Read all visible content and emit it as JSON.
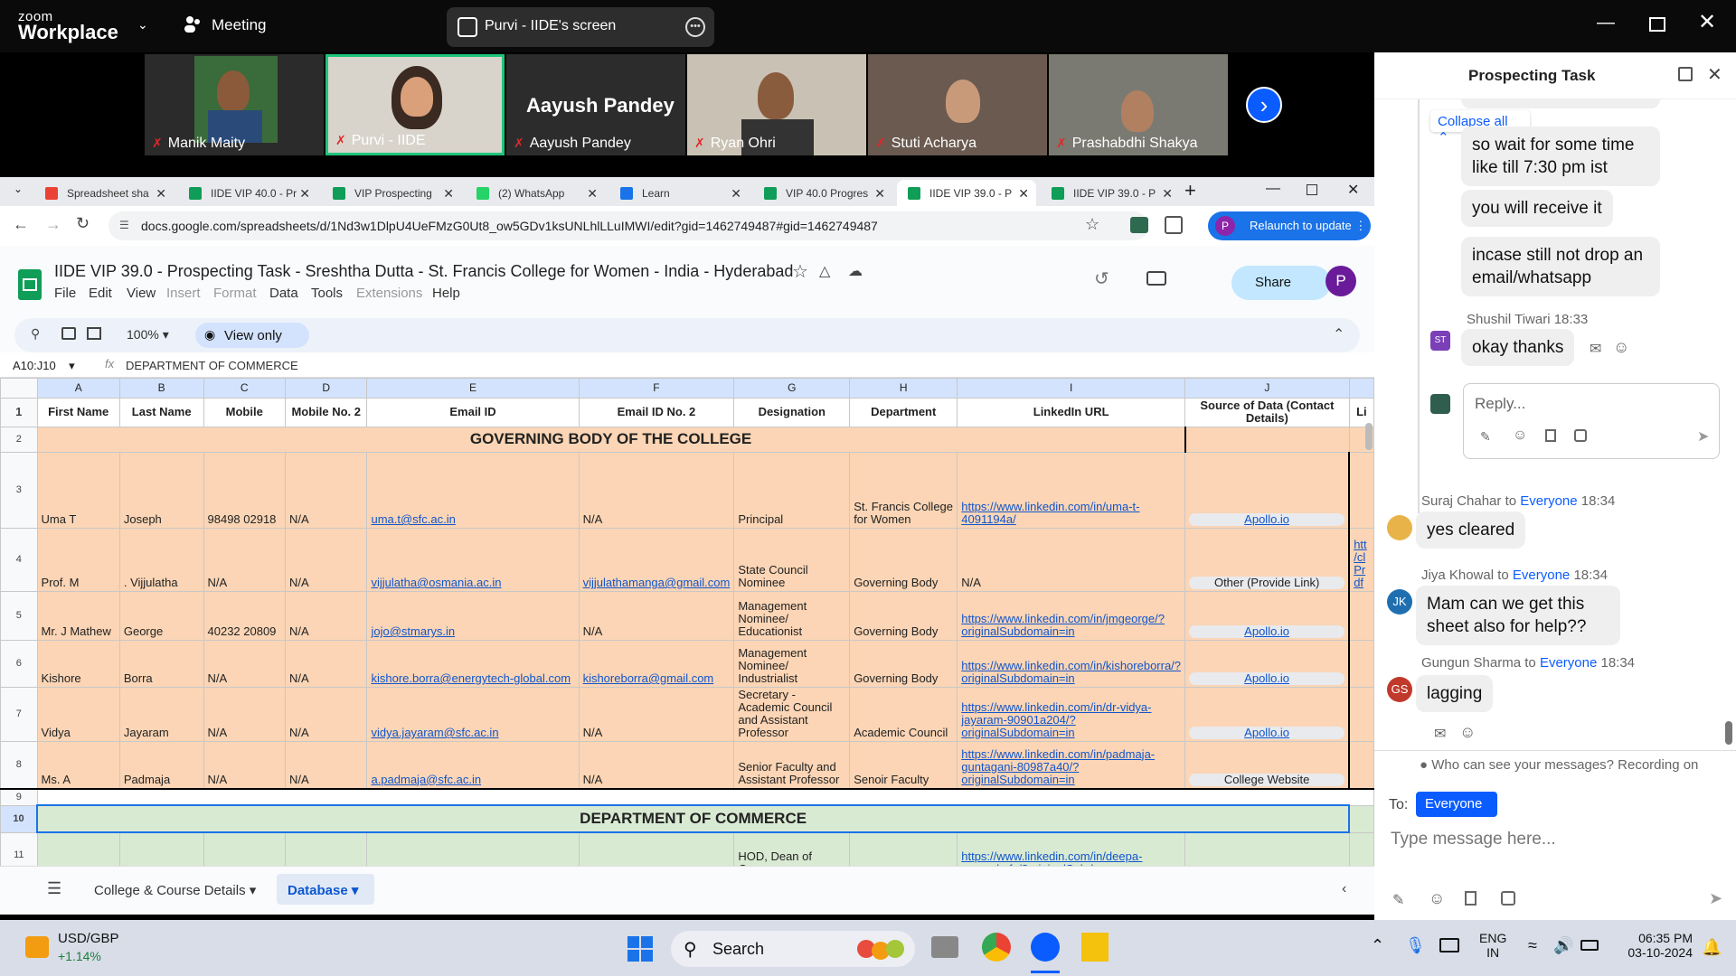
{
  "zoom": {
    "logo_top": "zoom",
    "logo_bottom": "Workplace",
    "meeting_label": "Meeting",
    "share_label": "Purvi - IIDE's screen",
    "participants": [
      {
        "name": "Manik Maity"
      },
      {
        "name": "Purvi - IIDE"
      },
      {
        "name": "Aayush Pandey",
        "big": "Aayush Pandey"
      },
      {
        "name": "Ryan Ohri"
      },
      {
        "name": "Stuti Acharya"
      },
      {
        "name": "Prashabdhi Shakya"
      }
    ]
  },
  "chat": {
    "title": "Prospecting Task",
    "collapse_label": "Collapse all",
    "thread_messages": [
      "so wait for some time like till 7:30 pm ist",
      "you will receive it",
      "incase still not drop an email/whatsapp"
    ],
    "reply_author": "Shushil Tiwari",
    "reply_time": "18:33",
    "reply_initials": "ST",
    "reply_text": "okay thanks",
    "reply_placeholder": "Reply...",
    "messages": [
      {
        "author": "Suraj Chahar",
        "to": "Everyone",
        "time": "18:34",
        "text": "yes cleared",
        "initials": ""
      },
      {
        "author": "Jiya Khowal",
        "to": "Everyone",
        "time": "18:34",
        "text": "Mam can we get this sheet also for help??",
        "initials": "JK"
      },
      {
        "author": "Gungun Sharma",
        "to": "Everyone",
        "time": "18:34",
        "text": "lagging",
        "initials": "GS"
      }
    ],
    "to_word": "to",
    "privacy_note": "Who can see your messages? Recording on",
    "to_label": "To:",
    "to_value": "Everyone",
    "input_placeholder": "Type message here..."
  },
  "browser": {
    "tabs": [
      {
        "label": "Spreadsheet sha",
        "color": "#ea4335"
      },
      {
        "label": "IIDE VIP 40.0 - Pr",
        "color": "#0f9d58"
      },
      {
        "label": "VIP Prospecting",
        "color": "#0f9d58"
      },
      {
        "label": "(2) WhatsApp",
        "color": "#25d366"
      },
      {
        "label": "Learn",
        "color": "#1a73e8"
      },
      {
        "label": "VIP 40.0 Progres",
        "color": "#0f9d58"
      },
      {
        "label": "IIDE VIP 39.0 - P",
        "color": "#0f9d58"
      },
      {
        "label": "IIDE VIP 39.0 - P",
        "color": "#0f9d58"
      }
    ],
    "url": "docs.google.com/spreadsheets/d/1Nd3w1DlpU4UeFMzG0Ut8_ow5GDv1ksUNLhlLLuIMWI/edit?gid=1462749487#gid=1462749487",
    "relaunch": "Relaunch to update",
    "profile_initial": "P"
  },
  "sheets": {
    "title": "IIDE VIP 39.0 - Prospecting Task - Sreshtha Dutta - St. Francis College for Women - India - Hyderabad",
    "menus": [
      "File",
      "Edit",
      "View",
      "Insert",
      "Format",
      "Data",
      "Tools",
      "Extensions",
      "Help"
    ],
    "zoom": "100%",
    "view_only": "View only",
    "share": "Share",
    "avatar": "P",
    "cell_ref": "A10:J10",
    "formula": "DEPARTMENT OF COMMERCE",
    "col_letters": [
      "A",
      "B",
      "C",
      "D",
      "E",
      "F",
      "G",
      "H",
      "I",
      "J",
      "K"
    ],
    "headers": [
      "First Name",
      "Last Name",
      "Mobile",
      "Mobile No. 2",
      "Email ID",
      "Email ID No. 2",
      "Designation",
      "Department",
      "LinkedIn URL",
      "Source of Data (Contact Details)",
      "Li"
    ],
    "section1": "GOVERNING BODY OF THE COLLEGE",
    "section2": "DEPARTMENT OF COMMERCE",
    "rows": [
      {
        "n": "3",
        "a": "Uma T",
        "b": "Joseph",
        "c": "98498 02918",
        "d": "N/A",
        "e": "uma.t@sfc.ac.in",
        "f": "N/A",
        "g": "Principal",
        "h": "St. Francis College for Women",
        "i": "https://www.linkedin.com/in/uma-t-4091194a/",
        "j": "Apollo.io",
        "k": ""
      },
      {
        "n": "4",
        "a": "Prof. M",
        "b": ". Vijjulatha",
        "c": "N/A",
        "d": "N/A",
        "e": "vijjulatha@osmania.ac.in",
        "f": "vijjulathamanga@gmail.com",
        "g": "State Council Nominee",
        "h": "Governing Body",
        "i": "N/A",
        "j": "Other (Provide Link)",
        "k": "htt /cl Pr df"
      },
      {
        "n": "5",
        "a": "Mr. J Mathew",
        "b": "George",
        "c": "40232 20809",
        "d": "N/A",
        "e": "jojo@stmarys.in",
        "f": "N/A",
        "g": "Management Nominee/ Educationist",
        "h": "Governing Body",
        "i": "https://www.linkedin.com/in/jmgeorge/?originalSubdomain=in",
        "j": "Apollo.io",
        "k": ""
      },
      {
        "n": "6",
        "a": "Kishore",
        "b": "Borra",
        "c": "N/A",
        "d": "N/A",
        "e": "kishore.borra@energytech-global.com",
        "f": "kishoreborra@gmail.com",
        "g": "Management Nominee/ Industrialist",
        "h": "Governing Body",
        "i": "https://www.linkedin.com/in/kishoreborra/?originalSubdomain=in",
        "j": "Apollo.io",
        "k": ""
      },
      {
        "n": "7",
        "a": "Vidya",
        "b": "Jayaram",
        "c": "N/A",
        "d": "N/A",
        "e": "vidya.jayaram@sfc.ac.in",
        "f": "N/A",
        "g": "Secretary - Academic Council and Assistant Professor",
        "h": "Academic Council",
        "i": "https://www.linkedin.com/in/dr-vidya-jayaram-90901a204/?originalSubdomain=in",
        "j": "Apollo.io",
        "k": ""
      },
      {
        "n": "8",
        "a": "Ms. A",
        "b": "Padmaja",
        "c": "N/A",
        "d": "N/A",
        "e": "a.padmaja@sfc.ac.in",
        "f": "N/A",
        "g": "Senior Faculty and Assistant Professor",
        "h": "Senoir Faculty",
        "i": "https://www.linkedin.com/in/padmaja-guntagani-80987a40/?originalSubdomain=in",
        "j": "College Website",
        "k": ""
      }
    ],
    "row11": {
      "g": "HOD, Dean of Commerce",
      "i": "https://www.linkedin.com/in/deepa-samuel-sfc/?originalSubd"
    },
    "sheet_tabs": [
      "College & Course Details",
      "Database"
    ]
  },
  "taskbar": {
    "ticker": "USD/GBP",
    "change": "+1.14%",
    "search": "Search",
    "lang1": "ENG",
    "lang2": "IN",
    "time": "06:35 PM",
    "date": "03-10-2024"
  }
}
